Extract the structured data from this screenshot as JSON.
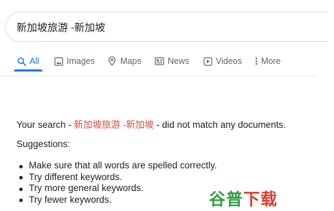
{
  "search": {
    "query": "新加坡旅游 -新加坡"
  },
  "tabs": [
    {
      "label": "All",
      "icon": "search-icon",
      "active": true
    },
    {
      "label": "Images",
      "icon": "image-icon",
      "active": false
    },
    {
      "label": "Maps",
      "icon": "map-pin-icon",
      "active": false
    },
    {
      "label": "News",
      "icon": "news-icon",
      "active": false
    },
    {
      "label": "Videos",
      "icon": "video-icon",
      "active": false
    },
    {
      "label": "More",
      "icon": "more-vertical-icon",
      "active": false
    }
  ],
  "result": {
    "prefix": "Your search - ",
    "query": "新加坡旅游 -新加坡",
    "suffix": " - did not match any documents.",
    "suggestions_title": "Suggestions:",
    "suggestions": [
      "Make sure that all words are spelled correctly.",
      "Try different keywords.",
      "Try more general keywords.",
      "Try fewer keywords."
    ]
  },
  "watermark": {
    "part1": "谷普",
    "part2": "下载"
  },
  "colors": {
    "accent": "#1a73e8",
    "query_red": "#dd4b39",
    "tab_gray": "#5f6368",
    "watermark_green": "#2f9e3f",
    "watermark_red": "#e03b2a"
  }
}
